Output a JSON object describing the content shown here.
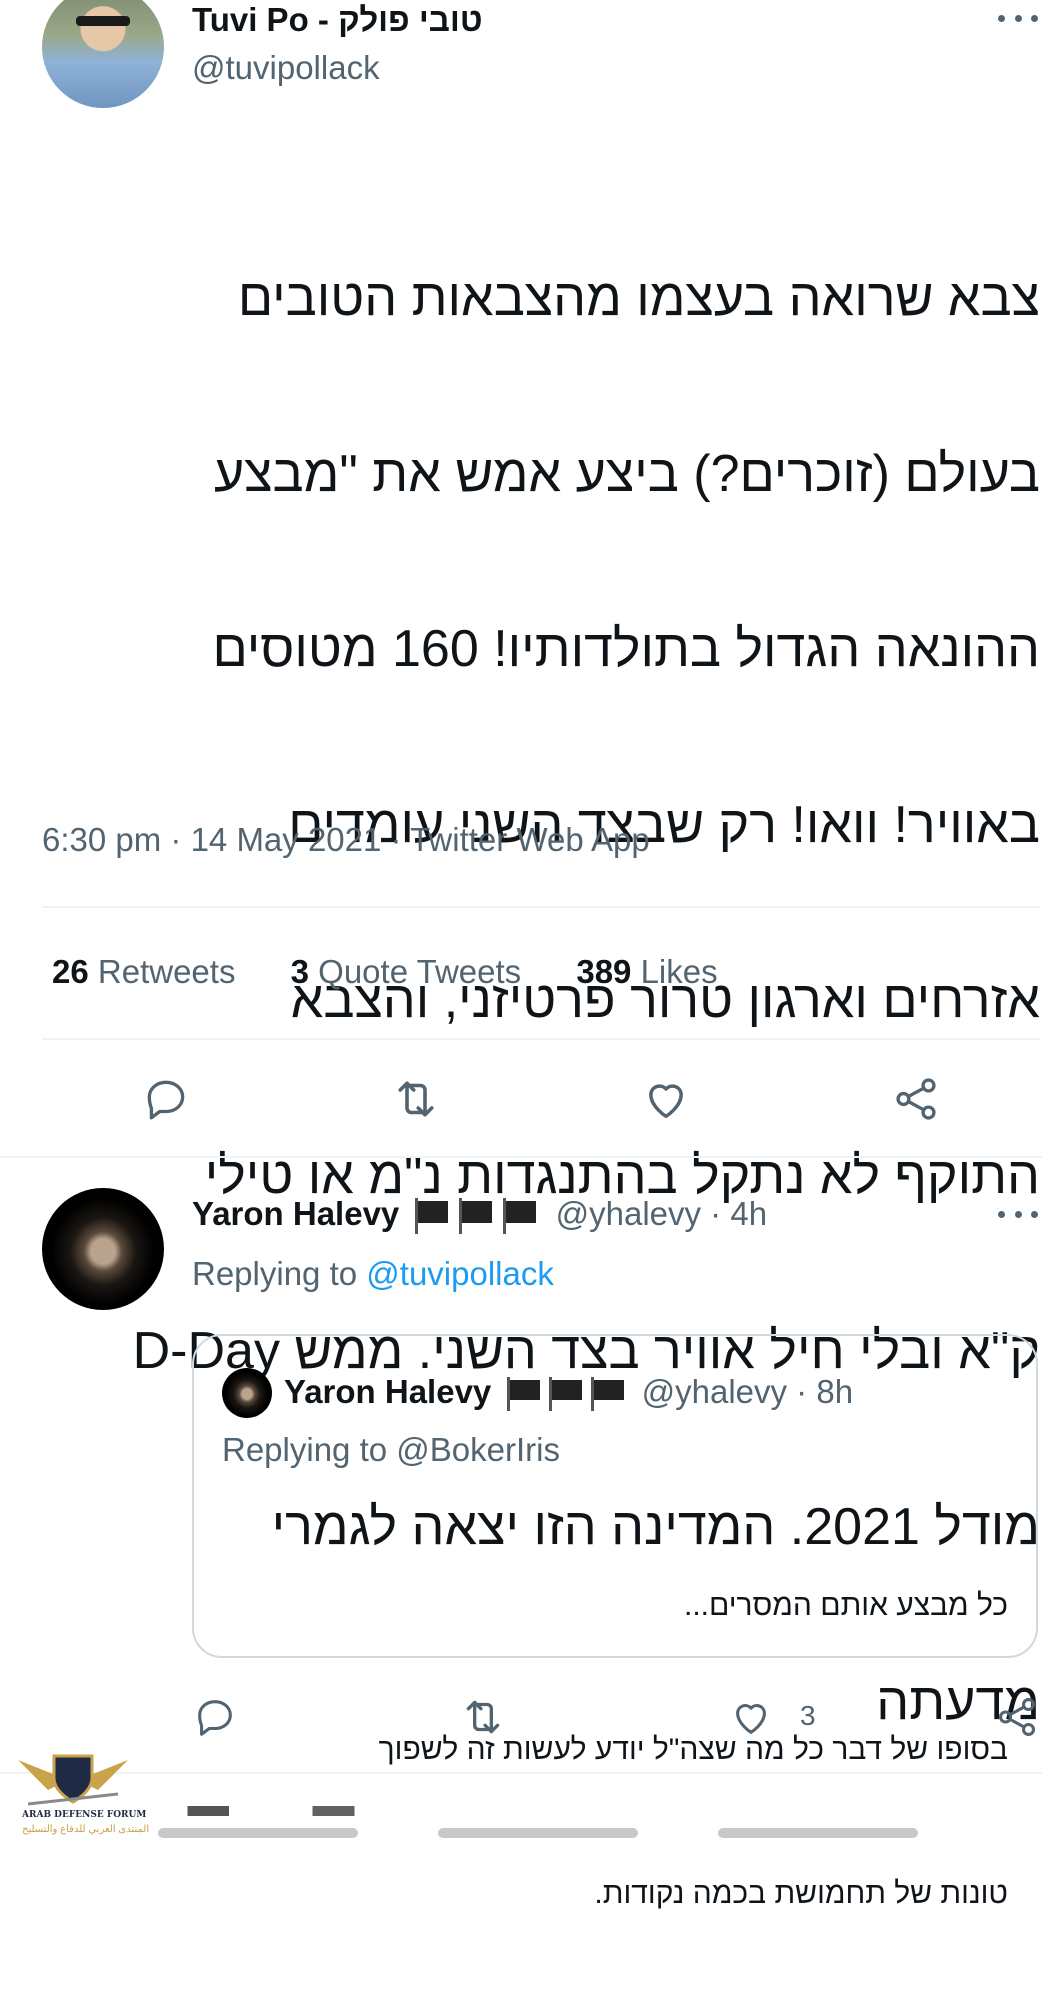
{
  "tweet": {
    "display_name": "Tuvi Po - טובי פולק",
    "handle": "@tuvipollack",
    "body_lines": [
      "צבא שרואה בעצמו מהצבאות הטובים",
      "בעולם (זוכרים?) ביצע אמש את \"מבצע",
      "ההונאה הגדול בתולדותיו! 160 מטוסים",
      "באוויר! וואו! רק שבצד השני עומדים",
      "אזרחים וארגון טרור פרטיזני, והצבא",
      "התוקף לא נתקל בהתנגדות נ\"מ או טילי",
      "ק\"א ובלי חיל אוויר בצד השני. ממש D-Day",
      "מודל 2021. המדינה הזו יצאה לגמרי ",
      "מדעתה"
    ],
    "meta": "6:30 pm · 14 May 2021 · Twitter Web App",
    "stats": {
      "retweets_count": "26",
      "retweets_label": "Retweets",
      "quotes_count": "3",
      "quotes_label": "Quote Tweets",
      "likes_count": "389",
      "likes_label": "Likes"
    },
    "icons": [
      "reply-icon",
      "retweet-icon",
      "like-icon",
      "share-icon"
    ]
  },
  "reply": {
    "display_name": "Yaron Halevy",
    "handle_time": "@yhalevy · 4h",
    "replying_prefix": "Replying to",
    "replying_handle": "@tuvipollack",
    "like_count": "3",
    "quoted": {
      "display_name": "Yaron Halevy",
      "handle_time": "@yhalevy · 8h",
      "replying_text": "Replying to @BokerIris",
      "body_lines": [
        "כל מבצע אותם המסרים...",
        "בסופו של דבר כל מה שצה\"ל יודע לעשות זה לשפוך",
        "טונות של תחמושת בכמה נקודות."
      ]
    }
  },
  "watermark": {
    "title": "ARAB DEFENSE FORUM",
    "subtitle": "المنتدى العربي للدفاع والتسليح"
  },
  "colors": {
    "text": "#0f1419",
    "muted": "#536471",
    "link": "#1d9bf0",
    "divider": "#eff3f4"
  }
}
